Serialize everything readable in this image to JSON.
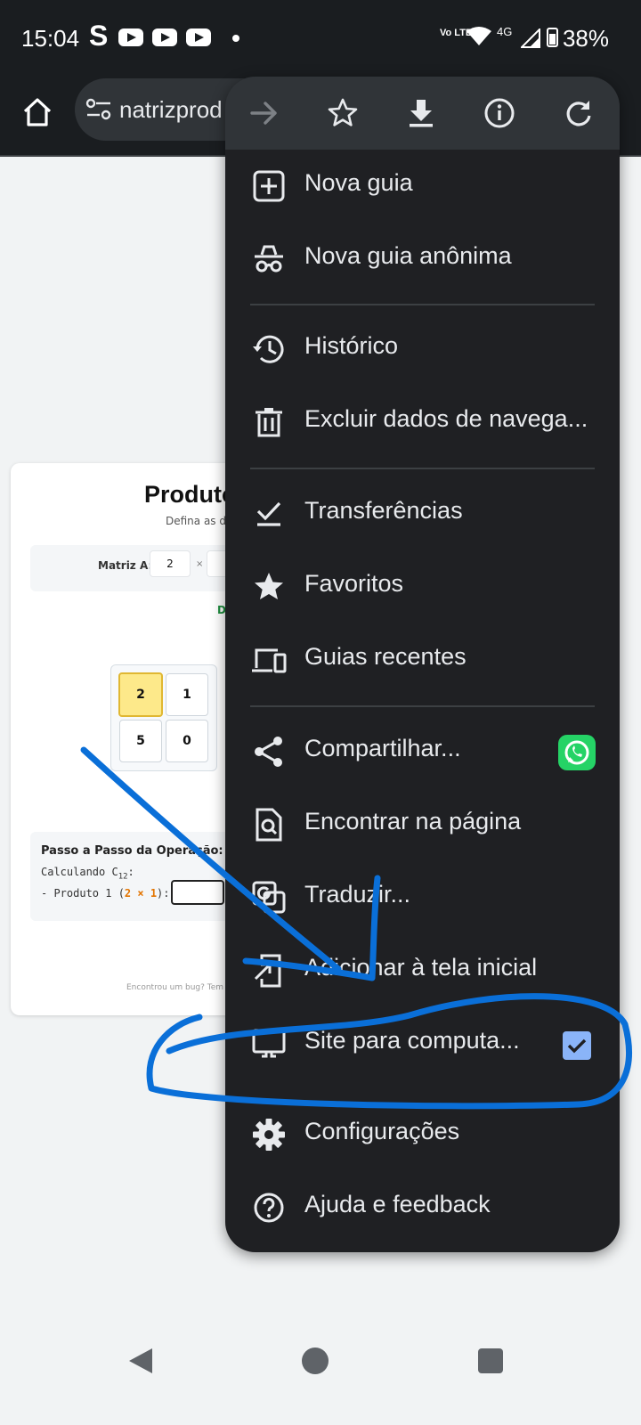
{
  "status_bar": {
    "time": "15:04",
    "app_letter": "S",
    "network_lte": "Vo LTE",
    "network_type": "4G",
    "battery": "38%"
  },
  "browser": {
    "url_fragment": "natrizprod"
  },
  "page": {
    "title": "Produto",
    "subtitle": "Defina as dim",
    "matrix_label": "Matriz A:",
    "rows_value": "2",
    "times": "×",
    "green_text": "D",
    "matrix_cells": [
      "2",
      "1",
      "5",
      "0"
    ],
    "steps_title": "Passo a Passo da Operação:",
    "steps_calc": "Calculando C",
    "steps_calc_sub": "12",
    "steps_calc_suffix": ":",
    "steps_product_prefix": "- Produto 1 (",
    "steps_product_hl": "2 × 1",
    "steps_product_suffix": "):",
    "footer": "Encontrou um bug? Tem alg"
  },
  "menu": {
    "items": [
      {
        "label": "Nova guia",
        "icon": "new-tab-icon"
      },
      {
        "label": "Nova guia anônima",
        "icon": "incognito-icon"
      },
      {
        "label": "Histórico",
        "icon": "history-icon"
      },
      {
        "label": "Excluir dados de navega...",
        "icon": "trash-icon"
      },
      {
        "label": "Transferências",
        "icon": "downloads-icon"
      },
      {
        "label": "Favoritos",
        "icon": "star-icon"
      },
      {
        "label": "Guias recentes",
        "icon": "devices-icon"
      },
      {
        "label": "Compartilhar...",
        "icon": "share-icon"
      },
      {
        "label": "Encontrar na página",
        "icon": "find-in-page-icon"
      },
      {
        "label": "Traduzir...",
        "icon": "translate-icon"
      },
      {
        "label": "Adicionar à tela inicial",
        "icon": "add-to-home-icon"
      },
      {
        "label": "Site para computa...",
        "icon": "desktop-icon",
        "checked": true
      },
      {
        "label": "Configurações",
        "icon": "gear-icon"
      },
      {
        "label": "Ajuda e feedback",
        "icon": "help-icon"
      }
    ]
  },
  "colors": {
    "menu_bg": "#1f2023",
    "menu_text": "#e8eaed",
    "annotation_blue": "#0a6fd8",
    "checkbox": "#8ab4f8",
    "whatsapp": "#25d366"
  }
}
